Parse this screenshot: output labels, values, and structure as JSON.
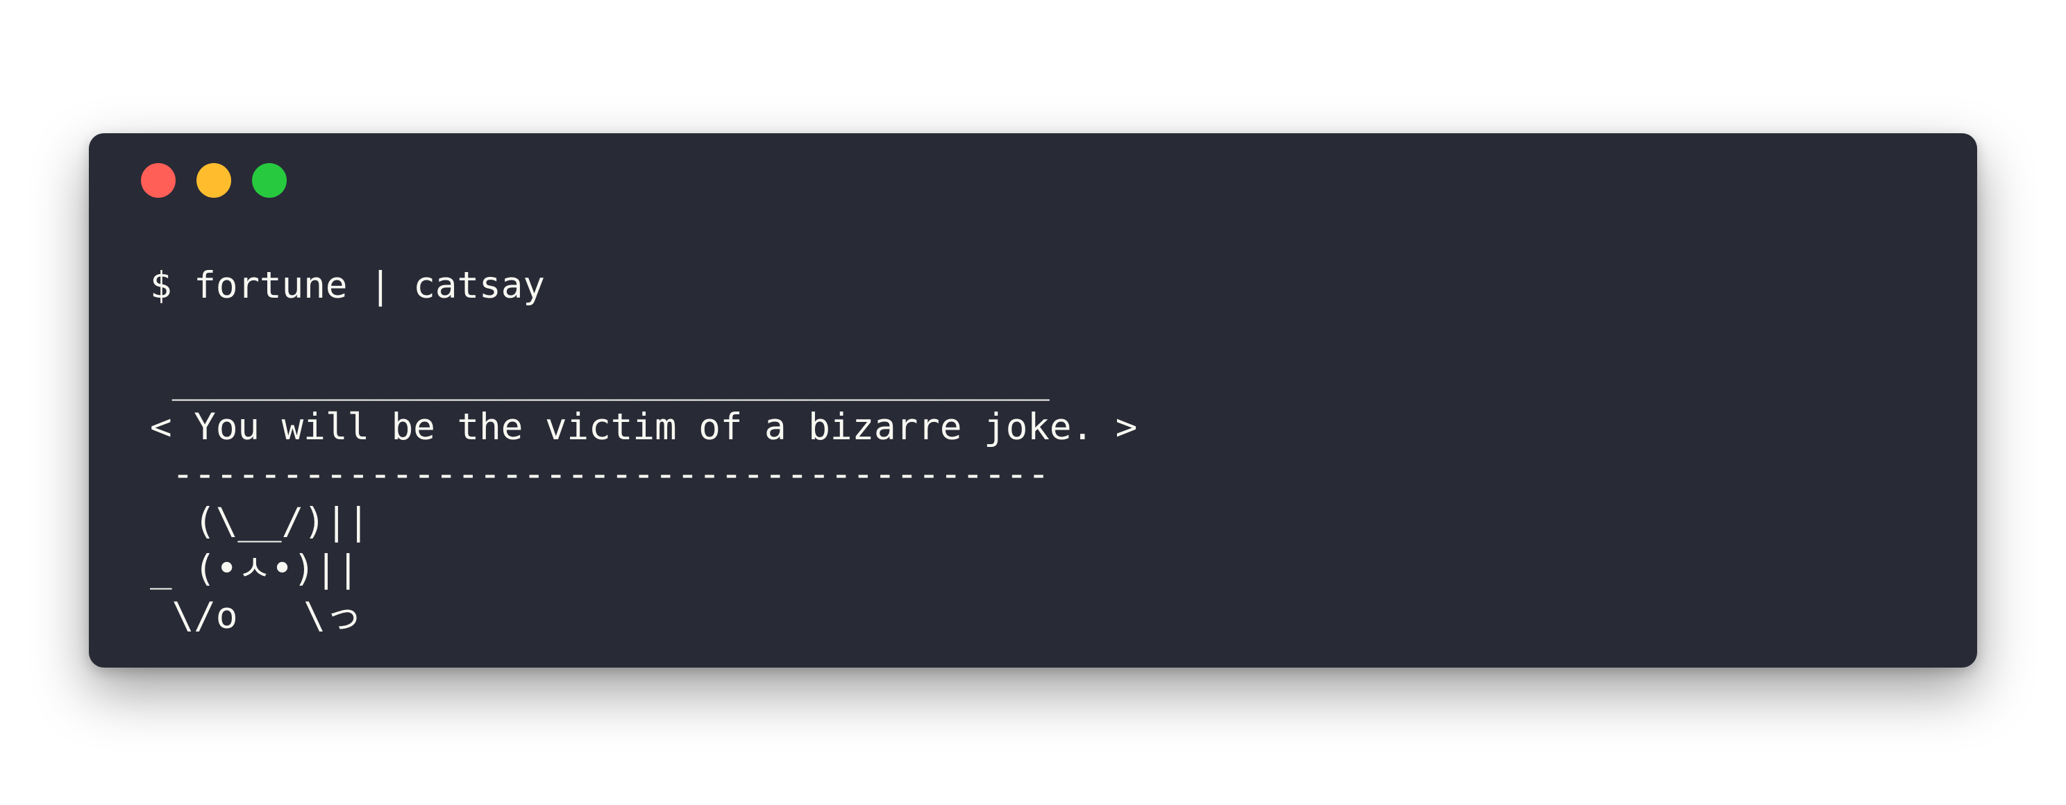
{
  "window": {
    "buttons": {
      "close": "close",
      "minimize": "minimize",
      "zoom": "zoom"
    },
    "colors": {
      "background": "#282a36",
      "text": "#f8f8f2",
      "close": "#ff5f56",
      "minimize": "#ffbd2e",
      "zoom": "#27c93f"
    }
  },
  "terminal": {
    "command": "$ fortune | catsay",
    "output": [
      " ________________________________________",
      "< You will be the victim of a bizarre joke. >",
      " ----------------------------------------",
      "  (\\__/)||",
      "_ (•ㅅ•)||",
      " \\/o   \\っ"
    ]
  }
}
